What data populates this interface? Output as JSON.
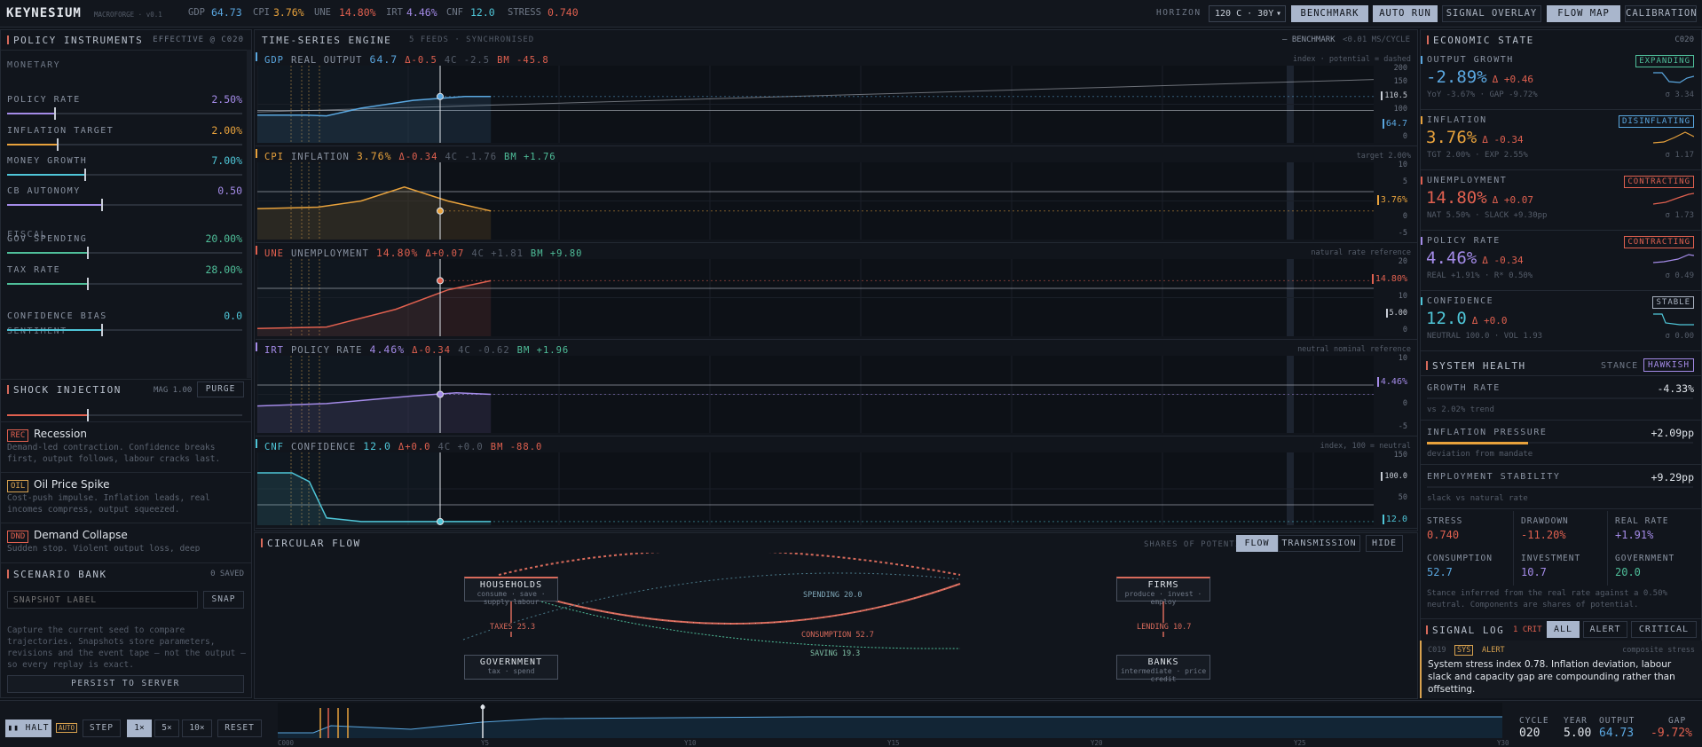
{
  "topbar": {
    "brand": "KEYNESIUM",
    "sub": "MACROFORGE · v0.1",
    "stats": [
      {
        "k": "GDP",
        "v": "64.73",
        "c": "#5aa7e0"
      },
      {
        "k": "CPI",
        "v": "3.76%",
        "c": "#e8a23c"
      },
      {
        "k": "UNE",
        "v": "14.80%",
        "c": "#e0604f"
      },
      {
        "k": "IRT",
        "v": "4.46%",
        "c": "#a48be8"
      },
      {
        "k": "CNF",
        "v": "12.0",
        "c": "#4fc6d8"
      },
      {
        "k": "STRESS",
        "v": "0.740",
        "c": "#e0604f"
      }
    ],
    "horizon_label": "HORIZON",
    "horizon_value": "120 C · 30Y",
    "buttons": [
      "BENCHMARK",
      "AUTO RUN",
      "SIGNAL OVERLAY",
      "FLOW MAP",
      "CALIBRATION"
    ]
  },
  "policy": {
    "title": "POLICY INSTRUMENTS",
    "effective": "EFFECTIVE @ C020",
    "sections": [
      "MONETARY",
      "FISCAL",
      "SENTIMENT"
    ],
    "sliders": [
      {
        "name": "POLICY RATE",
        "value": "2.50%",
        "color": "#a48be8",
        "level": 0.2
      },
      {
        "name": "INFLATION TARGET",
        "value": "2.00%",
        "color": "#e8a23c",
        "level": 0.21
      },
      {
        "name": "MONEY GROWTH",
        "value": "7.00%",
        "color": "#4fc6d8",
        "level": 0.33
      },
      {
        "name": "CB AUTONOMY",
        "value": "0.50",
        "color": "#a48be8",
        "level": 0.4
      },
      {
        "name": "GOV SPENDING",
        "value": "20.00%",
        "color": "#4fbf9a",
        "level": 0.34
      },
      {
        "name": "TAX RATE",
        "value": "28.00%",
        "color": "#4fbf9a",
        "level": 0.34
      },
      {
        "name": "CONFIDENCE BIAS",
        "value": "0.0",
        "color": "#4fc6d8",
        "level": 0.4
      }
    ]
  },
  "shock": {
    "title": "SHOCK INJECTION",
    "mag": "MAG 1.00",
    "purge": "PURGE",
    "level": 0.34,
    "items": [
      {
        "tag": "REC",
        "name": "Recession",
        "desc": "Demand-led contraction. Confidence breaks first, output follows, labour cracks last."
      },
      {
        "tag": "OIL",
        "name": "Oil Price Spike",
        "desc": "Cost-push impulse. Inflation leads, real incomes compress, output squeezed."
      },
      {
        "tag": "DND",
        "name": "Demand Collapse",
        "desc": "Sudden stop. Violent output loss, deep scarring, biphasic"
      }
    ]
  },
  "scenario": {
    "title": "SCENARIO BANK",
    "saved": "0 SAVED",
    "placeholder": "SNAPSHOT LABEL",
    "snap": "SNAP",
    "desc": "Capture the current seed to compare trajectories. Snapshots store parameters, revisions and the event tape — not the output — so every replay is exact.",
    "persist": "PERSIST TO SERVER"
  },
  "engine": {
    "title": "TIME-SERIES ENGINE",
    "feeds": "5 FEEDS · SYNCHRONISED",
    "bench": "— BENCHMARK",
    "rate": "<0.01 MS/CYCLE",
    "charts": [
      {
        "code": "GDP",
        "name": "REAL OUTPUT",
        "value": "64.7",
        "delta": "Δ-0.5",
        "d4": "4C -2.5",
        "bm": "BM -45.8",
        "note": "index · potential = dashed",
        "ticks": [
          "200",
          "150",
          "110.5",
          "100",
          "64.7",
          "0"
        ],
        "color": "#5aa7e0",
        "pill": "64.7",
        "ref": "110.5"
      },
      {
        "code": "CPI",
        "name": "INFLATION",
        "value": "3.76%",
        "delta": "Δ-0.34",
        "d4": "4C -1.76",
        "bm": "BM +1.76",
        "note": "target 2.00%",
        "ticks": [
          "10",
          "5",
          "3.76%",
          "0",
          "-5"
        ],
        "color": "#e8a23c",
        "pill": "3.76%",
        "ref": ""
      },
      {
        "code": "UNE",
        "name": "UNEMPLOYMENT",
        "value": "14.80%",
        "delta": "Δ+0.07",
        "d4": "4C +1.81",
        "bm": "BM +9.80",
        "note": "natural rate reference",
        "ticks": [
          "20",
          "14.80%",
          "10",
          "5.00",
          "0"
        ],
        "color": "#e0604f",
        "pill": "14.80%",
        "ref": "5.00"
      },
      {
        "code": "IRT",
        "name": "POLICY RATE",
        "value": "4.46%",
        "delta": "Δ-0.34",
        "d4": "4C -0.62",
        "bm": "BM +1.96",
        "note": "neutral nominal reference",
        "ticks": [
          "10",
          "4.46%",
          "0",
          "-5"
        ],
        "color": "#a48be8",
        "pill": "4.46%",
        "ref": ""
      },
      {
        "code": "CNF",
        "name": "CONFIDENCE",
        "value": "12.0",
        "delta": "Δ+0.0",
        "d4": "4C +0.0",
        "bm": "BM -88.0",
        "note": "index, 100 = neutral",
        "ticks": [
          "150",
          "100.0",
          "50",
          "12.0"
        ],
        "color": "#4fc6d8",
        "pill": "12.0",
        "ref": "100.0"
      }
    ]
  },
  "flow": {
    "title": "CIRCULAR FLOW",
    "shares": "SHARES OF POTENTIAL",
    "tabs": [
      "FLOW",
      "TRANSMISSION",
      "HIDE"
    ],
    "nodes": [
      {
        "name": "HOUSEHOLDS",
        "sub": "consume · save · supply labour"
      },
      {
        "name": "FIRMS",
        "sub": "produce · invest · employ"
      },
      {
        "name": "GOVERNMENT",
        "sub": "tax · spend"
      },
      {
        "name": "BANKS",
        "sub": "intermediate · price credit"
      }
    ],
    "edges": [
      "SPENDING 20.0",
      "TAXES 25.3",
      "CONSUMPTION 52.7",
      "LENDING 10.7",
      "SAVING 19.3"
    ]
  },
  "econ": {
    "title": "ECONOMIC STATE",
    "cycle": "C020",
    "metrics": [
      {
        "name": "OUTPUT GROWTH",
        "value": "-2.89%",
        "delta": "Δ +0.46",
        "sub": "YoY -3.67% · GAP -9.72%",
        "badge": "EXPANDING",
        "sigma": "σ 3.34",
        "color": "#5aa7e0",
        "badge_color": "#4fbf9a"
      },
      {
        "name": "INFLATION",
        "value": "3.76%",
        "delta": "Δ -0.34",
        "sub": "TGT 2.00% · EXP 2.55%",
        "badge": "DISINFLATING",
        "sigma": "σ 1.17",
        "color": "#e8a23c",
        "badge_color": "#5aa7e0"
      },
      {
        "name": "UNEMPLOYMENT",
        "value": "14.80%",
        "delta": "Δ +0.07",
        "sub": "NAT 5.50% · SLACK +9.30pp",
        "badge": "CONTRACTING",
        "sigma": "σ 1.73",
        "color": "#e0604f",
        "badge_color": "#e0604f"
      },
      {
        "name": "POLICY RATE",
        "value": "4.46%",
        "delta": "Δ -0.34",
        "sub": "REAL +1.91% · R* 0.50%",
        "badge": "CONTRACTING",
        "sigma": "σ 0.49",
        "color": "#a48be8",
        "badge_color": "#e0604f"
      },
      {
        "name": "CONFIDENCE",
        "value": "12.0",
        "delta": "Δ +0.0",
        "sub": "NEUTRAL 100.0 · VOL 1.93",
        "badge": "STABLE",
        "sigma": "σ 0.00",
        "color": "#4fc6d8",
        "badge_color": "#a9b2c0"
      }
    ]
  },
  "health": {
    "title": "SYSTEM HEALTH",
    "stance_label": "STANCE",
    "stance": "HAWKISH",
    "rows": [
      {
        "name": "GROWTH RATE",
        "value": "-4.33%",
        "sub": "vs 2.02% trend",
        "level": 0
      },
      {
        "name": "INFLATION PRESSURE",
        "value": "+2.09pp",
        "sub": "deviation from mandate",
        "level": 0.38
      },
      {
        "name": "EMPLOYMENT STABILITY",
        "value": "+9.29pp",
        "sub": "slack vs natural rate",
        "level": 0
      }
    ],
    "grid": [
      {
        "k": "STRESS",
        "v": "0.740",
        "c": "#e0604f"
      },
      {
        "k": "DRAWDOWN",
        "v": "-11.20%",
        "c": "#e0604f"
      },
      {
        "k": "REAL RATE",
        "v": "+1.91%",
        "c": "#a48be8"
      },
      {
        "k": "CONSUMPTION",
        "v": "52.7",
        "c": "#5aa7e0"
      },
      {
        "k": "INVESTMENT",
        "v": "10.7",
        "c": "#a48be8"
      },
      {
        "k": "GOVERNMENT",
        "v": "20.0",
        "c": "#4fbf9a"
      }
    ],
    "note": "Stance inferred from the real rate against a 0.50% neutral. Components are shares of potential."
  },
  "signal": {
    "title": "SIGNAL LOG",
    "crit": "1 CRIT",
    "tabs": [
      "ALL",
      "ALERT",
      "CRITICAL"
    ],
    "entry": {
      "cycle": "C019",
      "src": "SYS",
      "level": "ALERT",
      "tag": "composite stress",
      "text": "System stress index 0.78. Inflation deviation, labour slack and capacity gap are compounding rather than offsetting."
    }
  },
  "bottom": {
    "halt": "▮▮ HALT",
    "auto": "AUTO",
    "step": "STEP",
    "speeds": [
      "1×",
      "5×",
      "10×"
    ],
    "reset": "RESET",
    "axis": [
      "C000",
      "Y5",
      "Y10",
      "Y15",
      "Y20",
      "Y25",
      "Y30"
    ],
    "readouts": [
      {
        "k": "CYCLE",
        "v": "020",
        "c": "#dfe4ea"
      },
      {
        "k": "YEAR",
        "v": "5.00",
        "c": "#dfe4ea"
      },
      {
        "k": "OUTPUT",
        "v": "64.73",
        "c": "#5aa7e0"
      },
      {
        "k": "GAP",
        "v": "-9.72%",
        "c": "#e0604f"
      }
    ]
  }
}
